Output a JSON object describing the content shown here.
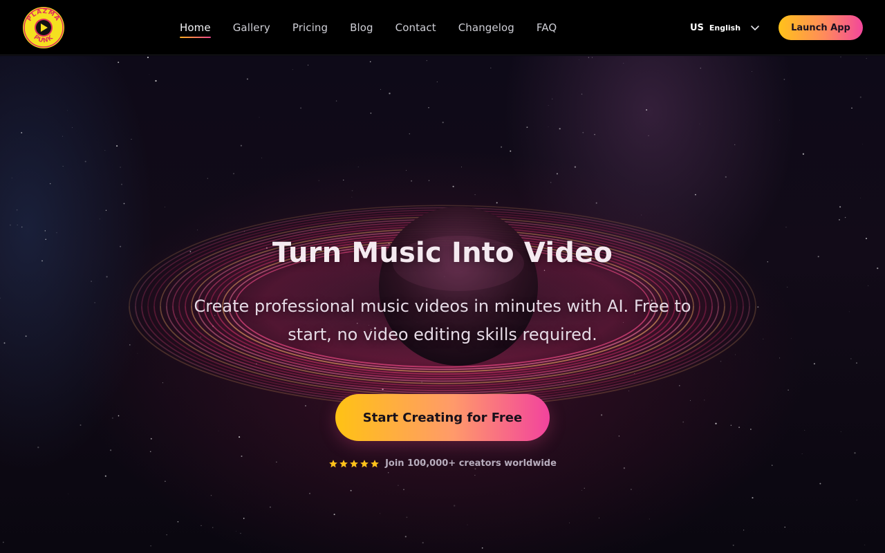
{
  "brand": {
    "logo_text_top": "PLAZMA",
    "logo_text_bottom": "PUNK",
    "logo_color": "#f5e020",
    "logo_accent": "#e0305a",
    "logo_icon": "play-icon"
  },
  "nav": {
    "items": [
      {
        "label": "Home",
        "active": true
      },
      {
        "label": "Gallery",
        "active": false
      },
      {
        "label": "Pricing",
        "active": false
      },
      {
        "label": "Blog",
        "active": false
      },
      {
        "label": "Contact",
        "active": false
      },
      {
        "label": "Changelog",
        "active": false
      },
      {
        "label": "FAQ",
        "active": false
      }
    ]
  },
  "language": {
    "flag": "US",
    "label": "English",
    "icon": "chevron-down-icon"
  },
  "header": {
    "launch_label": "Launch App"
  },
  "hero": {
    "title": "Turn Music Into Video",
    "subtitle": "Create professional music videos in minutes with AI. Free to start, no video editing skills required.",
    "cta_label": "Start Creating for Free",
    "rating_stars": 5,
    "social_proof": "Join 100,000+ creators worldwide"
  },
  "colors": {
    "accent_start": "#ffc214",
    "accent_end": "#f2439d",
    "star": "#ffc21a",
    "background": "#05040a"
  }
}
